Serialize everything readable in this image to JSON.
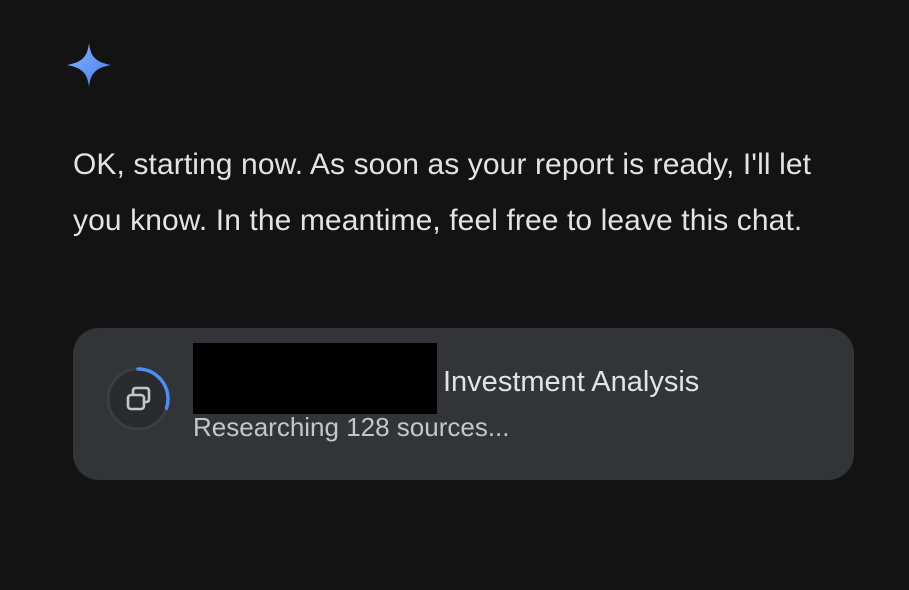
{
  "assistant": {
    "icon": "sparkle-icon",
    "colors": {
      "spark_light": "#8ab4f8",
      "spark_dark": "#4c8df6"
    }
  },
  "message": {
    "text": "OK, starting now. As soon as your report is ready, I'll let you know. In the meantime, feel free to leave this chat."
  },
  "research_card": {
    "title": "Investment Analysis",
    "status": "Researching 128 sources...",
    "icon": "research-windows-icon",
    "progress_fraction": 0.3,
    "title_redacted": true,
    "colors": {
      "background": "#333437",
      "progress_accent": "#4c8df6",
      "ring_track": "#2a2b2e"
    }
  }
}
